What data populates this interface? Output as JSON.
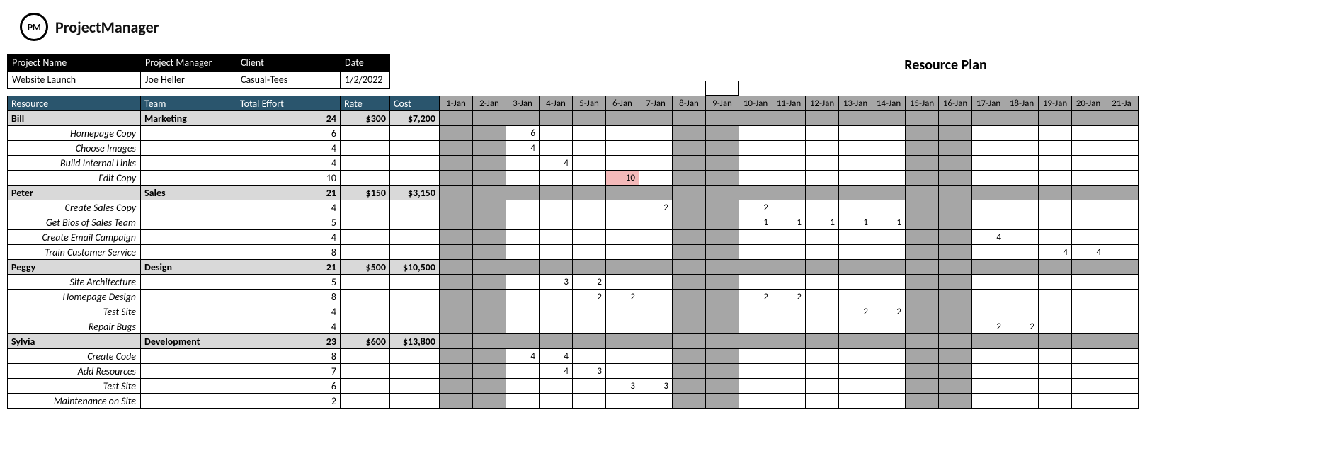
{
  "app": {
    "logo_text": "PM",
    "name": "ProjectManager"
  },
  "title": "Resource Plan",
  "info_headers": {
    "project_name": "Project Name",
    "project_manager": "Project Manager",
    "client": "Client",
    "date": "Date"
  },
  "info": {
    "project_name": "Website Launch",
    "project_manager": "Joe Heller",
    "client": "Casual-Tees",
    "date": "1/2/2022"
  },
  "columns": {
    "resource": "Resource",
    "team": "Team",
    "total_effort": "Total Effort",
    "rate": "Rate",
    "cost": "Cost"
  },
  "days": [
    "1-Jan",
    "2-Jan",
    "3-Jan",
    "4-Jan",
    "5-Jan",
    "6-Jan",
    "7-Jan",
    "8-Jan",
    "9-Jan",
    "10-Jan",
    "11-Jan",
    "12-Jan",
    "13-Jan",
    "14-Jan",
    "15-Jan",
    "16-Jan",
    "17-Jan",
    "18-Jan",
    "19-Jan",
    "20-Jan",
    "21-Ja"
  ],
  "weekend_idx": [
    0,
    1,
    7,
    8,
    14,
    15
  ],
  "rows": [
    {
      "type": "group",
      "resource": "Bill",
      "team": "Marketing",
      "total_effort": "24",
      "rate": "$300",
      "cost": "$7,200",
      "cells": [
        "",
        "",
        "",
        "",
        "",
        "",
        "",
        "",
        "",
        "",
        "",
        "",
        "",
        "",
        "",
        "",
        "",
        "",
        "",
        "",
        ""
      ]
    },
    {
      "type": "task",
      "resource": "Homepage Copy",
      "total_effort": "6",
      "cells": [
        "",
        "",
        "6",
        "",
        "",
        "",
        "",
        "",
        "",
        "",
        "",
        "",
        "",
        "",
        "",
        "",
        "",
        "",
        "",
        "",
        ""
      ]
    },
    {
      "type": "task",
      "resource": "Choose Images",
      "total_effort": "4",
      "cells": [
        "",
        "",
        "4",
        "",
        "",
        "",
        "",
        "",
        "",
        "",
        "",
        "",
        "",
        "",
        "",
        "",
        "",
        "",
        "",
        "",
        ""
      ]
    },
    {
      "type": "task",
      "resource": "Build Internal Links",
      "total_effort": "4",
      "cells": [
        "",
        "",
        "",
        "4",
        "",
        "",
        "",
        "",
        "",
        "",
        "",
        "",
        "",
        "",
        "",
        "",
        "",
        "",
        "",
        "",
        ""
      ]
    },
    {
      "type": "task",
      "resource": "Edit Copy",
      "total_effort": "10",
      "cells": [
        "",
        "",
        "",
        "",
        "",
        "10",
        "",
        "",
        "",
        "",
        "",
        "",
        "",
        "",
        "",
        "",
        "",
        "",
        "",
        "",
        ""
      ],
      "over_idx": [
        5
      ]
    },
    {
      "type": "group",
      "resource": "Peter",
      "team": "Sales",
      "total_effort": "21",
      "rate": "$150",
      "cost": "$3,150",
      "cells": [
        "",
        "",
        "",
        "",
        "",
        "",
        "",
        "",
        "",
        "",
        "",
        "",
        "",
        "",
        "",
        "",
        "",
        "",
        "",
        "",
        ""
      ]
    },
    {
      "type": "task",
      "resource": "Create Sales Copy",
      "total_effort": "4",
      "cells": [
        "",
        "",
        "",
        "",
        "",
        "",
        "2",
        "",
        "",
        "2",
        "",
        "",
        "",
        "",
        "",
        "",
        "",
        "",
        "",
        "",
        ""
      ]
    },
    {
      "type": "task",
      "resource": "Get Bios of Sales Team",
      "total_effort": "5",
      "cells": [
        "",
        "",
        "",
        "",
        "",
        "",
        "",
        "",
        "",
        "1",
        "1",
        "1",
        "1",
        "1",
        "",
        "",
        "",
        "",
        "",
        "",
        ""
      ]
    },
    {
      "type": "task",
      "resource": "Create Email Campaign",
      "total_effort": "4",
      "cells": [
        "",
        "",
        "",
        "",
        "",
        "",
        "",
        "",
        "",
        "",
        "",
        "",
        "",
        "",
        "",
        "",
        "4",
        "",
        "",
        "",
        ""
      ]
    },
    {
      "type": "task",
      "resource": "Train Customer Service",
      "total_effort": "8",
      "cells": [
        "",
        "",
        "",
        "",
        "",
        "",
        "",
        "",
        "",
        "",
        "",
        "",
        "",
        "",
        "",
        "",
        "",
        "",
        "4",
        "4",
        ""
      ]
    },
    {
      "type": "group",
      "resource": "Peggy",
      "team": "Design",
      "total_effort": "21",
      "rate": "$500",
      "cost": "$10,500",
      "cells": [
        "",
        "",
        "",
        "",
        "",
        "",
        "",
        "",
        "",
        "",
        "",
        "",
        "",
        "",
        "",
        "",
        "",
        "",
        "",
        "",
        ""
      ]
    },
    {
      "type": "task",
      "resource": "Site Architecture",
      "total_effort": "5",
      "cells": [
        "",
        "",
        "",
        "3",
        "2",
        "",
        "",
        "",
        "",
        "",
        "",
        "",
        "",
        "",
        "",
        "",
        "",
        "",
        "",
        "",
        ""
      ]
    },
    {
      "type": "task",
      "resource": "Homepage Design",
      "total_effort": "8",
      "cells": [
        "",
        "",
        "",
        "",
        "2",
        "2",
        "",
        "",
        "",
        "2",
        "2",
        "",
        "",
        "",
        "",
        "",
        "",
        "",
        "",
        "",
        ""
      ]
    },
    {
      "type": "task",
      "resource": "Test Site",
      "total_effort": "4",
      "cells": [
        "",
        "",
        "",
        "",
        "",
        "",
        "",
        "",
        "",
        "",
        "",
        "",
        "2",
        "2",
        "",
        "",
        "",
        "",
        "",
        "",
        ""
      ]
    },
    {
      "type": "task",
      "resource": "Repair Bugs",
      "total_effort": "4",
      "cells": [
        "",
        "",
        "",
        "",
        "",
        "",
        "",
        "",
        "",
        "",
        "",
        "",
        "",
        "",
        "",
        "",
        "2",
        "2",
        "",
        "",
        ""
      ]
    },
    {
      "type": "group",
      "resource": "Sylvia",
      "team": "Development",
      "total_effort": "23",
      "rate": "$600",
      "cost": "$13,800",
      "cells": [
        "",
        "",
        "",
        "",
        "",
        "",
        "",
        "",
        "",
        "",
        "",
        "",
        "",
        "",
        "",
        "",
        "",
        "",
        "",
        "",
        ""
      ]
    },
    {
      "type": "task",
      "resource": "Create Code",
      "total_effort": "8",
      "cells": [
        "",
        "",
        "4",
        "4",
        "",
        "",
        "",
        "",
        "",
        "",
        "",
        "",
        "",
        "",
        "",
        "",
        "",
        "",
        "",
        "",
        ""
      ]
    },
    {
      "type": "task",
      "resource": "Add Resources",
      "total_effort": "7",
      "cells": [
        "",
        "",
        "",
        "4",
        "3",
        "",
        "",
        "",
        "",
        "",
        "",
        "",
        "",
        "",
        "",
        "",
        "",
        "",
        "",
        "",
        ""
      ]
    },
    {
      "type": "task",
      "resource": "Test Site",
      "total_effort": "6",
      "cells": [
        "",
        "",
        "",
        "",
        "",
        "3",
        "3",
        "",
        "",
        "",
        "",
        "",
        "",
        "",
        "",
        "",
        "",
        "",
        "",
        "",
        ""
      ]
    },
    {
      "type": "task",
      "resource": "Maintenance on Site",
      "total_effort": "2",
      "cells": [
        "",
        "",
        "",
        "",
        "",
        "",
        "",
        "",
        "",
        "",
        "",
        "",
        "",
        "",
        "",
        "",
        "",
        "",
        "",
        "",
        ""
      ]
    }
  ]
}
